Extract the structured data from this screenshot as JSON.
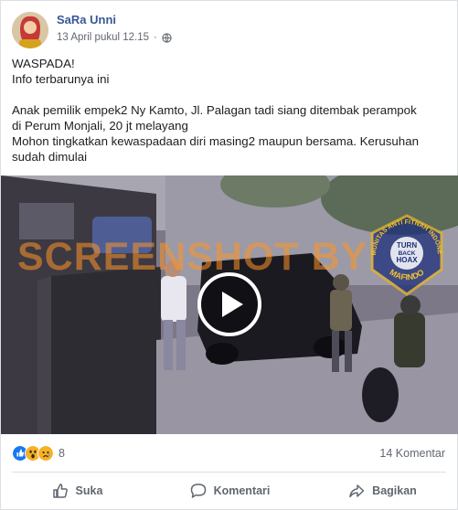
{
  "post": {
    "author": "SaRa Unni",
    "timestamp": "13 April pukul 12.15",
    "separator": "·",
    "audience_icon": "globe-icon",
    "text_lines": {
      "line1": "WASPADA!",
      "line2": "Info terbarunya ini",
      "line3": "Anak pemilik empek2 Ny Kamto, Jl. Palagan tadi siang ditembak perampok",
      "line4": "di Perum Monjali, 20 jt melayang",
      "line5": "Mohon tingkatkan kewaspadaan diri masing2 maupun bersama. Kerusuhan",
      "line6": "sudah dimulai"
    }
  },
  "video": {
    "watermark": "SCREENSHOT BY",
    "badge": {
      "top_text": "KOMUNITAS ANTI FITNAH INDONESIA",
      "center_line1": "TURN",
      "center_line2": "BACK",
      "center_line3": "HOAX",
      "bottom_text": "MAFINDO"
    },
    "play_icon": "play-icon"
  },
  "engagement": {
    "reaction_icons": [
      "like-icon",
      "wow-icon",
      "sad-icon"
    ],
    "reaction_count": "8",
    "comments": "14 Komentar"
  },
  "actions": {
    "like": "Suka",
    "comment": "Komentari",
    "share": "Bagikan"
  },
  "colors": {
    "author_link": "#385898",
    "secondary_text": "#616770",
    "like_blue": "#1877f2",
    "reaction_yellow": "#f7b125",
    "watermark_orange": "#ff9628"
  }
}
